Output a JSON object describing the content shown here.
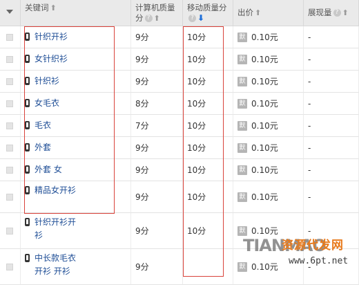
{
  "header": {
    "keyword": "关键词",
    "pc_quality": "计算机质量分",
    "mobile_quality": "移动质量分",
    "bid": "出价",
    "impressions": "展现量"
  },
  "rows": [
    {
      "keyword": "针织开衫",
      "pc": "9分",
      "mobile": "10分",
      "bid": "0.10元",
      "impr": "-"
    },
    {
      "keyword": "女针织衫",
      "pc": "9分",
      "mobile": "10分",
      "bid": "0.10元",
      "impr": "-"
    },
    {
      "keyword": "针织衫",
      "pc": "9分",
      "mobile": "10分",
      "bid": "0.10元",
      "impr": "-"
    },
    {
      "keyword": "女毛衣",
      "pc": "8分",
      "mobile": "10分",
      "bid": "0.10元",
      "impr": "-"
    },
    {
      "keyword": "毛衣",
      "pc": "7分",
      "mobile": "10分",
      "bid": "0.10元",
      "impr": "-"
    },
    {
      "keyword": "外套",
      "pc": "9分",
      "mobile": "10分",
      "bid": "0.10元",
      "impr": "-"
    },
    {
      "keyword": "外套 女",
      "pc": "9分",
      "mobile": "10分",
      "bid": "0.10元",
      "impr": "-"
    },
    {
      "keyword": "精品女开衫",
      "pc": "9分",
      "mobile": "10分",
      "bid": "0.10元",
      "impr": "-"
    },
    {
      "keyword": "针织开衫开衫",
      "pc": "9分",
      "mobile": "10分",
      "bid": "0.10元",
      "impr": "-"
    },
    {
      "keyword": "中长款毛衣开衫 开衫",
      "pc": "9分",
      "mobile": "",
      "bid": "0.10元",
      "impr": "-"
    }
  ],
  "icons": {
    "device": "mobile-phone-icon",
    "price_tag": "默",
    "help": "?",
    "sort_up": "⬆",
    "sort_down": "⬇"
  },
  "watermark": {
    "brand": "TIANMAO",
    "site": "资源代发网",
    "url": "www.6pt.net"
  },
  "colors": {
    "highlight_border": "#d9423a",
    "link": "#1f4e96",
    "sort_active": "#1e6fd9",
    "header_bg": "#eaeaea"
  }
}
